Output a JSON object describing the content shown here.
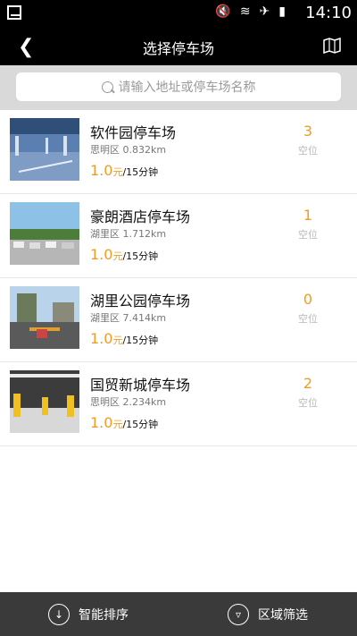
{
  "status_bar": {
    "time": "14:10",
    "icons": [
      "notification-icon",
      "mute-icon",
      "wifi-icon",
      "airplane-icon",
      "battery-icon"
    ]
  },
  "header": {
    "title": "选择停车场"
  },
  "search": {
    "placeholder": "请输入地址或停车场名称"
  },
  "lots": [
    {
      "name": "软件园停车场",
      "district": "思明区",
      "distance": "0.832km",
      "price": "1.0",
      "unit": "元",
      "per": "/15分钟",
      "spaces": "3",
      "spaces_label": "空位"
    },
    {
      "name": "豪朗酒店停车场",
      "district": "湖里区",
      "distance": "1.712km",
      "price": "1.0",
      "unit": "元",
      "per": "/15分钟",
      "spaces": "1",
      "spaces_label": "空位"
    },
    {
      "name": "湖里公园停车场",
      "district": "湖里区",
      "distance": "7.414km",
      "price": "1.0",
      "unit": "元",
      "per": "/15分钟",
      "spaces": "0",
      "spaces_label": "空位"
    },
    {
      "name": "国贸新城停车场",
      "district": "思明区",
      "distance": "2.234km",
      "price": "1.0",
      "unit": "元",
      "per": "/15分钟",
      "spaces": "2",
      "spaces_label": "空位"
    }
  ],
  "bottom_bar": {
    "sort_label": "智能排序",
    "filter_label": "区域筛选"
  },
  "colors": {
    "accent": "#f29c1f",
    "header": "#000000",
    "bottom": "#3a3a3a"
  }
}
